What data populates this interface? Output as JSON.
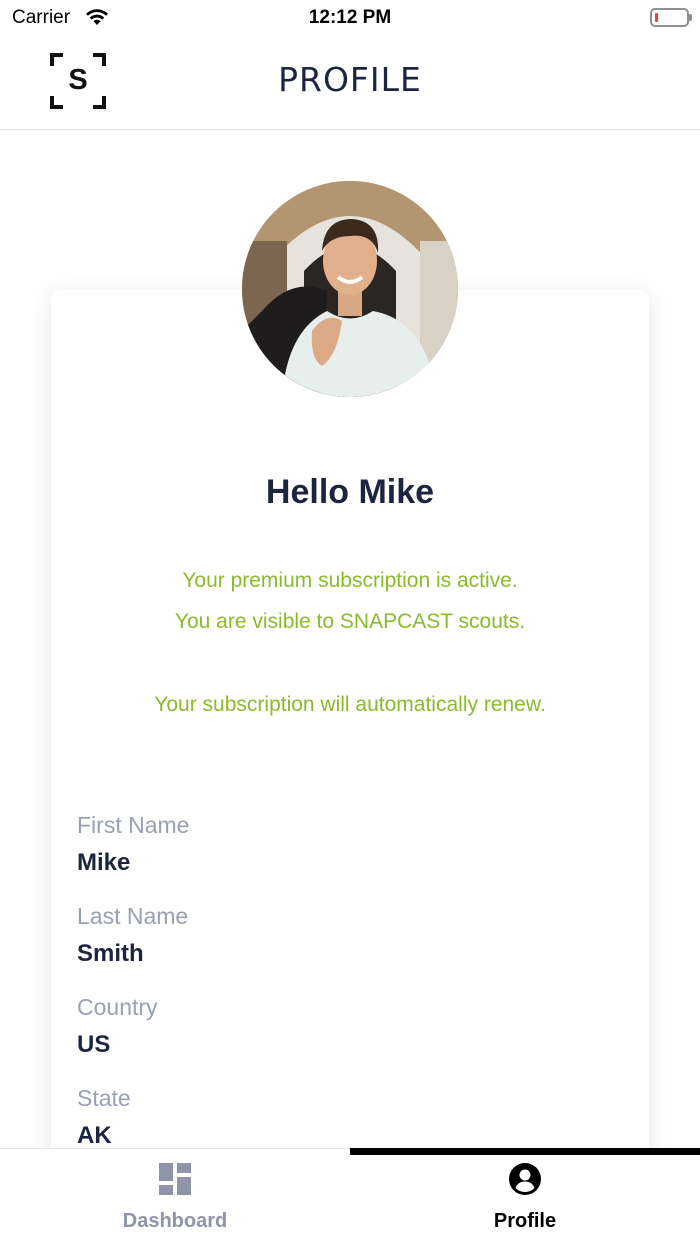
{
  "status_bar": {
    "carrier": "Carrier",
    "time": "12:12 PM"
  },
  "header": {
    "logo_letter": "S",
    "title": "PROFILE"
  },
  "profile": {
    "greeting": "Hello Mike",
    "subscription_messages": [
      "Your premium subscription is active.",
      "You are visible to SNAPCAST scouts.",
      "Your subscription will automatically renew."
    ],
    "fields": [
      {
        "label": "First Name",
        "value": "Mike"
      },
      {
        "label": "Last Name",
        "value": "Smith"
      },
      {
        "label": "Country",
        "value": "US"
      },
      {
        "label": "State",
        "value": "AK"
      }
    ]
  },
  "tab_bar": {
    "tabs": [
      {
        "label": "Dashboard",
        "icon": "dashboard-icon",
        "active": false
      },
      {
        "label": "Profile",
        "icon": "user-circle-icon",
        "active": true
      }
    ]
  },
  "colors": {
    "primary_text": "#1c2540",
    "accent_green": "#8bbb2b",
    "label_gray": "#9aa0b4",
    "inactive_tab": "#8e95a9"
  }
}
